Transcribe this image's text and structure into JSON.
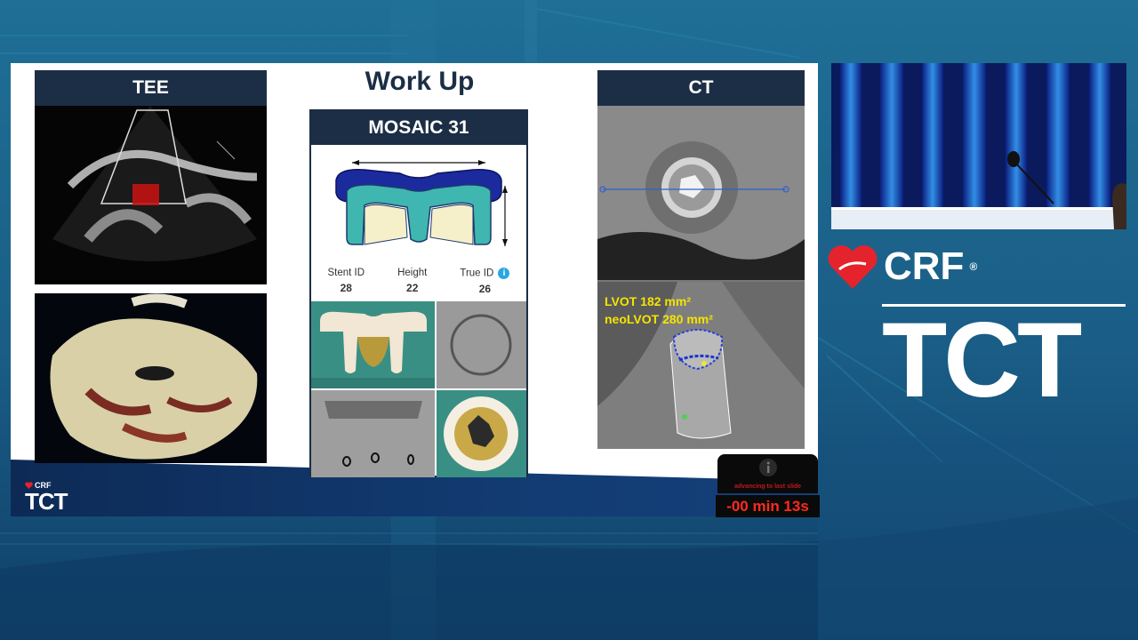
{
  "slide": {
    "title": "Work Up",
    "tee": {
      "header": "TEE"
    },
    "mosaic": {
      "header": "MOSAIC 31",
      "specs": [
        {
          "label": "Stent ID",
          "value": "28"
        },
        {
          "label": "Height",
          "value": "22"
        },
        {
          "label": "True ID",
          "value": "26"
        }
      ]
    },
    "ct": {
      "header": "CT",
      "annotations": [
        "LVOT 182 mm²",
        "neoLVOT 280 mm²"
      ]
    },
    "footer_logo": {
      "crf": "CRF",
      "tct": "TCT"
    }
  },
  "timer": {
    "message": "advancing to last slide",
    "countdown": "-00 min 13s"
  },
  "brand": {
    "crf": "CRF",
    "registered": "®",
    "tct": "TCT"
  },
  "colors": {
    "navy": "#1c2e45",
    "crf_red": "#e5232d",
    "timer_red": "#ff2a1f",
    "ct_yellow": "#f5e400"
  }
}
